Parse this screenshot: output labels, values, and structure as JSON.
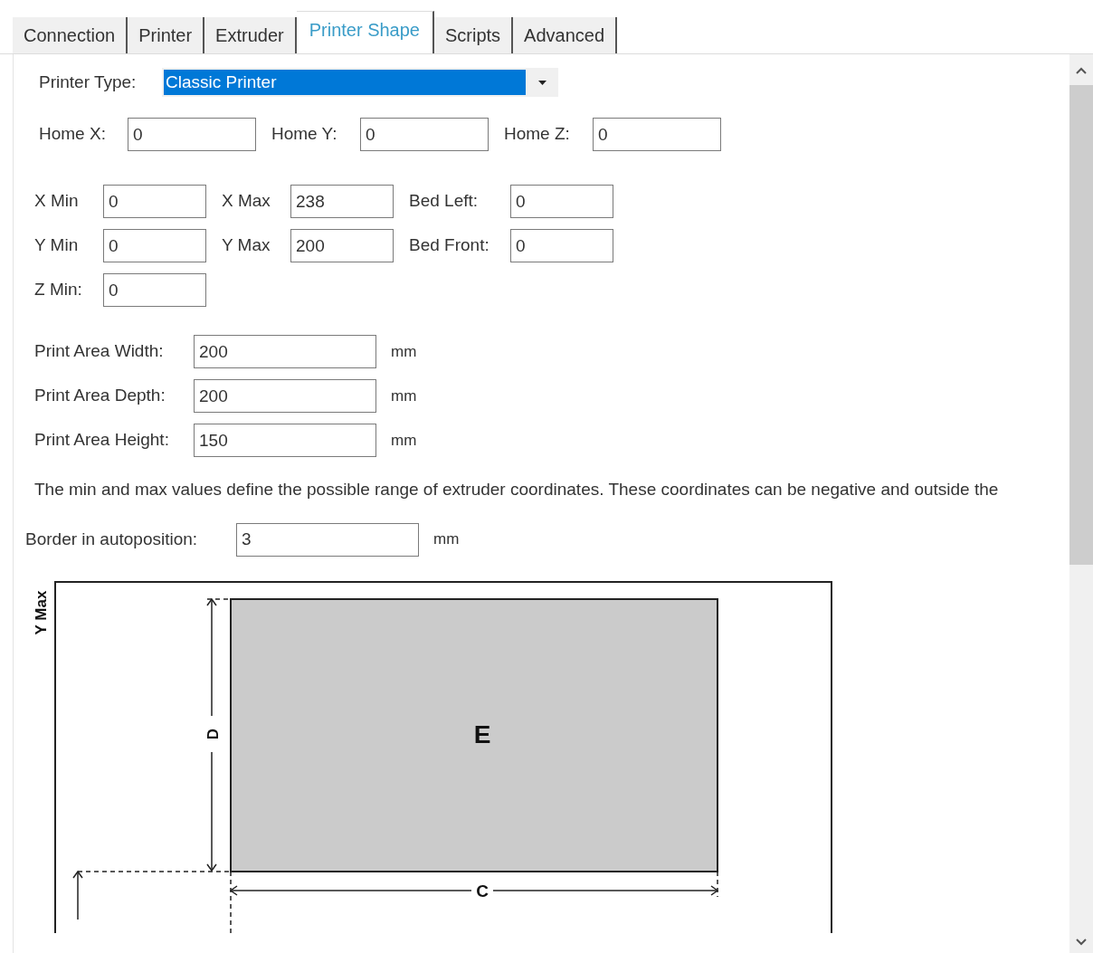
{
  "tabs": [
    {
      "label": "Connection",
      "selected": false
    },
    {
      "label": "Printer",
      "selected": false
    },
    {
      "label": "Extruder",
      "selected": false
    },
    {
      "label": "Printer Shape",
      "selected": true
    },
    {
      "label": "Scripts",
      "selected": false
    },
    {
      "label": "Advanced",
      "selected": false
    }
  ],
  "printer_type": {
    "label": "Printer Type:",
    "value": "Classic Printer"
  },
  "home": [
    {
      "label": "Home X:",
      "value": "0"
    },
    {
      "label": "Home Y:",
      "value": "0"
    },
    {
      "label": "Home Z:",
      "value": "0"
    }
  ],
  "limits": [
    [
      {
        "label": "X Min",
        "value": "0"
      },
      {
        "label": "X Max",
        "value": "238"
      },
      {
        "label": "Bed Left:",
        "value": "0"
      }
    ],
    [
      {
        "label": "Y Min",
        "value": "0"
      },
      {
        "label": "Y Max",
        "value": "200"
      },
      {
        "label": "Bed Front:",
        "value": "0"
      }
    ],
    [
      {
        "label": "Z Min:",
        "value": "0"
      }
    ]
  ],
  "print_area": [
    {
      "label": "Print Area Width:",
      "value": "200",
      "unit": "mm"
    },
    {
      "label": "Print Area Depth:",
      "value": "200",
      "unit": "mm"
    },
    {
      "label": "Print Area Height:",
      "value": "150",
      "unit": "mm"
    }
  ],
  "description": "The min and max values define the possible range of extruder coordinates. These coordinates can be negative and outside the",
  "border": {
    "label": "Border in autoposition:",
    "value": "3",
    "unit": "mm"
  },
  "diagram": {
    "y_axis_label": "Y Max",
    "depth_label": "D",
    "area_label": "E",
    "width_label": "C"
  }
}
